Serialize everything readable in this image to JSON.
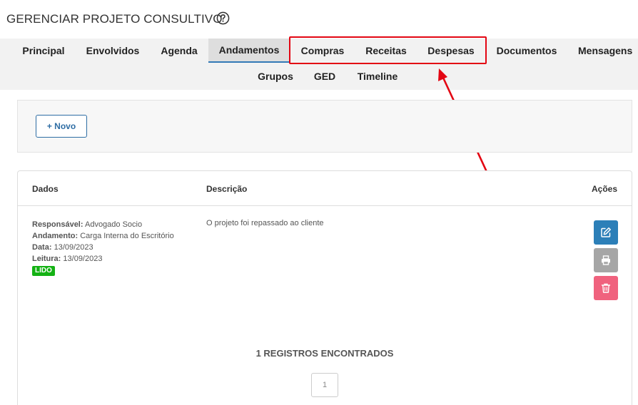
{
  "page": {
    "title": "GERENCIAR PROJETO CONSULTIVO"
  },
  "tabs": {
    "row1": [
      "Principal",
      "Envolvidos",
      "Agenda",
      "Andamentos",
      "Compras",
      "Receitas",
      "Despesas",
      "Documentos",
      "Mensagens"
    ],
    "row2": [
      "Grupos",
      "GED",
      "Timeline"
    ],
    "active": "Andamentos"
  },
  "toolbar": {
    "new_label": "+ Novo"
  },
  "table": {
    "headers": {
      "dados": "Dados",
      "descricao": "Descrição",
      "acoes": "Ações"
    },
    "rows": [
      {
        "responsavel_label": "Responsável:",
        "responsavel": "Advogado Socio",
        "andamento_label": "Andamento:",
        "andamento": "Carga Interna do Escritório",
        "data_label": "Data:",
        "data": "13/09/2023",
        "leitura_label": "Leitura:",
        "leitura": "13/09/2023",
        "status": "LIDO",
        "descricao": "O projeto foi repassado ao cliente"
      }
    ]
  },
  "footer": {
    "records": "1 REGISTROS ENCONTRADOS",
    "current_page": "1"
  },
  "colors": {
    "accent": "#337ab7",
    "annotation": "#e30613",
    "status_read": "#14b214",
    "edit": "#2c7fb8",
    "print": "#a6a6a6",
    "delete": "#f0627e"
  }
}
